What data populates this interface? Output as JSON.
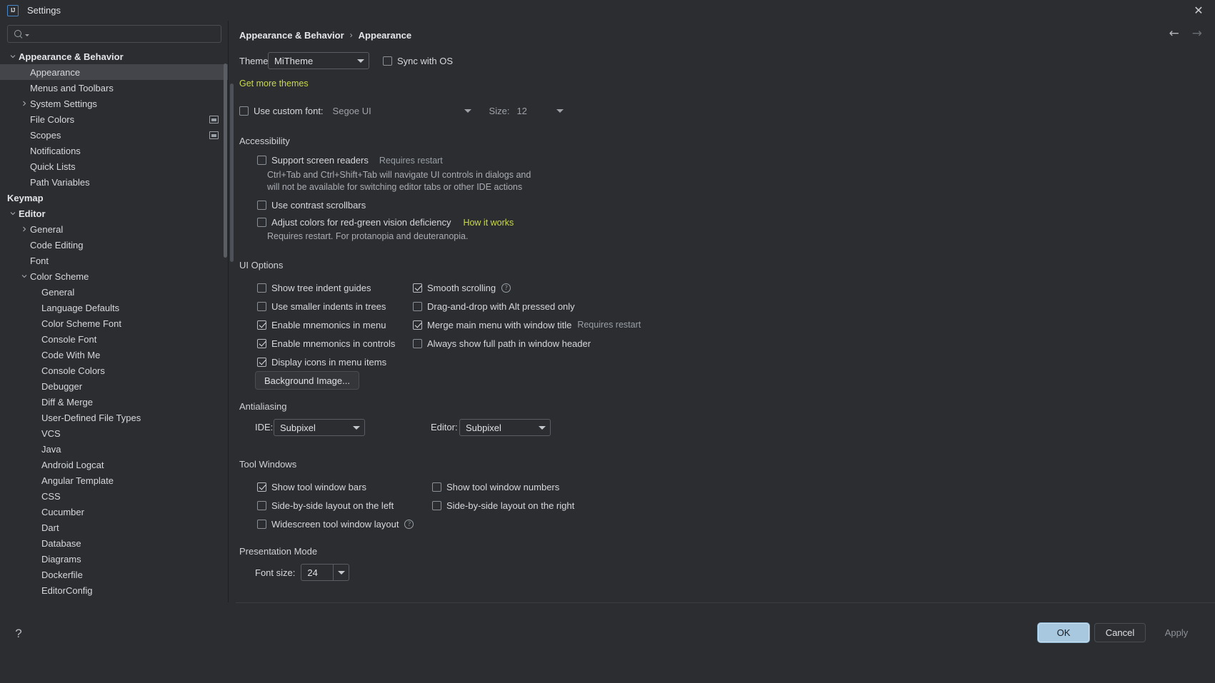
{
  "window": {
    "title": "Settings",
    "logo_text": "IJ",
    "close_label": "✕"
  },
  "search": {
    "value": "",
    "placeholder": ""
  },
  "sidebar": {
    "items": [
      {
        "label": "Appearance & Behavior",
        "level": 0,
        "twisty": "down",
        "bold": true,
        "selected": false,
        "trailing": false
      },
      {
        "label": "Appearance",
        "level": 1,
        "twisty": "none",
        "bold": false,
        "selected": true,
        "trailing": false
      },
      {
        "label": "Menus and Toolbars",
        "level": 1,
        "twisty": "none",
        "bold": false,
        "selected": false,
        "trailing": false
      },
      {
        "label": "System Settings",
        "level": 1,
        "twisty": "right",
        "bold": false,
        "selected": false,
        "trailing": false
      },
      {
        "label": "File Colors",
        "level": 1,
        "twisty": "none",
        "bold": false,
        "selected": false,
        "trailing": true
      },
      {
        "label": "Scopes",
        "level": 1,
        "twisty": "none",
        "bold": false,
        "selected": false,
        "trailing": true
      },
      {
        "label": "Notifications",
        "level": 1,
        "twisty": "none",
        "bold": false,
        "selected": false,
        "trailing": false
      },
      {
        "label": "Quick Lists",
        "level": 1,
        "twisty": "none",
        "bold": false,
        "selected": false,
        "trailing": false
      },
      {
        "label": "Path Variables",
        "level": 1,
        "twisty": "none",
        "bold": false,
        "selected": false,
        "trailing": false
      },
      {
        "label": "Keymap",
        "level": 0,
        "twisty": "none",
        "bold": true,
        "selected": false,
        "trailing": false
      },
      {
        "label": "Editor",
        "level": 0,
        "twisty": "down",
        "bold": true,
        "selected": false,
        "trailing": false
      },
      {
        "label": "General",
        "level": 1,
        "twisty": "right",
        "bold": false,
        "selected": false,
        "trailing": false
      },
      {
        "label": "Code Editing",
        "level": 1,
        "twisty": "none",
        "bold": false,
        "selected": false,
        "trailing": false
      },
      {
        "label": "Font",
        "level": 1,
        "twisty": "none",
        "bold": false,
        "selected": false,
        "trailing": false
      },
      {
        "label": "Color Scheme",
        "level": 1,
        "twisty": "down",
        "bold": false,
        "selected": false,
        "trailing": false
      },
      {
        "label": "General",
        "level": 2,
        "twisty": "none",
        "bold": false,
        "selected": false,
        "trailing": false
      },
      {
        "label": "Language Defaults",
        "level": 2,
        "twisty": "none",
        "bold": false,
        "selected": false,
        "trailing": false
      },
      {
        "label": "Color Scheme Font",
        "level": 2,
        "twisty": "none",
        "bold": false,
        "selected": false,
        "trailing": false
      },
      {
        "label": "Console Font",
        "level": 2,
        "twisty": "none",
        "bold": false,
        "selected": false,
        "trailing": false
      },
      {
        "label": "Code With Me",
        "level": 2,
        "twisty": "none",
        "bold": false,
        "selected": false,
        "trailing": false
      },
      {
        "label": "Console Colors",
        "level": 2,
        "twisty": "none",
        "bold": false,
        "selected": false,
        "trailing": false
      },
      {
        "label": "Debugger",
        "level": 2,
        "twisty": "none",
        "bold": false,
        "selected": false,
        "trailing": false
      },
      {
        "label": "Diff & Merge",
        "level": 2,
        "twisty": "none",
        "bold": false,
        "selected": false,
        "trailing": false
      },
      {
        "label": "User-Defined File Types",
        "level": 2,
        "twisty": "none",
        "bold": false,
        "selected": false,
        "trailing": false
      },
      {
        "label": "VCS",
        "level": 2,
        "twisty": "none",
        "bold": false,
        "selected": false,
        "trailing": false
      },
      {
        "label": "Java",
        "level": 2,
        "twisty": "none",
        "bold": false,
        "selected": false,
        "trailing": false
      },
      {
        "label": "Android Logcat",
        "level": 2,
        "twisty": "none",
        "bold": false,
        "selected": false,
        "trailing": false
      },
      {
        "label": "Angular Template",
        "level": 2,
        "twisty": "none",
        "bold": false,
        "selected": false,
        "trailing": false
      },
      {
        "label": "CSS",
        "level": 2,
        "twisty": "none",
        "bold": false,
        "selected": false,
        "trailing": false
      },
      {
        "label": "Cucumber",
        "level": 2,
        "twisty": "none",
        "bold": false,
        "selected": false,
        "trailing": false
      },
      {
        "label": "Dart",
        "level": 2,
        "twisty": "none",
        "bold": false,
        "selected": false,
        "trailing": false
      },
      {
        "label": "Database",
        "level": 2,
        "twisty": "none",
        "bold": false,
        "selected": false,
        "trailing": false
      },
      {
        "label": "Diagrams",
        "level": 2,
        "twisty": "none",
        "bold": false,
        "selected": false,
        "trailing": false
      },
      {
        "label": "Dockerfile",
        "level": 2,
        "twisty": "none",
        "bold": false,
        "selected": false,
        "trailing": false
      },
      {
        "label": "EditorConfig",
        "level": 2,
        "twisty": "none",
        "bold": false,
        "selected": false,
        "trailing": false
      }
    ]
  },
  "breadcrumb": {
    "parent": "Appearance & Behavior",
    "separator": "›",
    "current": "Appearance"
  },
  "nav": {
    "back": "←",
    "forward": "→"
  },
  "theme": {
    "label": "Theme:",
    "value": "MiTheme",
    "sync_label": "Sync with OS",
    "sync_checked": false,
    "get_more_link": "Get more themes"
  },
  "custom_font": {
    "label": "Use custom font:",
    "checked": false,
    "family": "Segoe UI",
    "size_label": "Size:",
    "size": "12"
  },
  "accessibility": {
    "title": "Accessibility",
    "screen_readers_label": "Support screen readers",
    "screen_readers_checked": false,
    "screen_readers_restart": "Requires restart",
    "screen_readers_desc_line1": "Ctrl+Tab and Ctrl+Shift+Tab will navigate UI controls in dialogs and",
    "screen_readers_desc_line2": "will not be available for switching editor tabs or other IDE actions",
    "contrast_scrollbars_label": "Use contrast scrollbars",
    "contrast_scrollbars_checked": false,
    "red_green_label": "Adjust colors for red-green vision deficiency",
    "red_green_checked": false,
    "how_it_works_link": "How it works",
    "red_green_desc": "Requires restart. For protanopia and deuteranopia."
  },
  "ui_options": {
    "title": "UI Options",
    "left": [
      {
        "label": "Show tree indent guides",
        "checked": false
      },
      {
        "label": "Use smaller indents in trees",
        "checked": false
      },
      {
        "label": "Enable mnemonics in menu",
        "checked": true
      },
      {
        "label": "Enable mnemonics in controls",
        "checked": true
      },
      {
        "label": "Display icons in menu items",
        "checked": true
      }
    ],
    "right": [
      {
        "label": "Smooth scrolling",
        "checked": true,
        "help": true,
        "suffix": ""
      },
      {
        "label": "Drag-and-drop with Alt pressed only",
        "checked": false,
        "help": false,
        "suffix": ""
      },
      {
        "label": "Merge main menu with window title",
        "checked": true,
        "help": false,
        "suffix": "Requires restart"
      },
      {
        "label": "Always show full path in window header",
        "checked": false,
        "help": false,
        "suffix": ""
      }
    ],
    "background_image_button": "Background Image..."
  },
  "antialiasing": {
    "title": "Antialiasing",
    "ide_label": "IDE:",
    "ide_value": "Subpixel",
    "editor_label": "Editor:",
    "editor_value": "Subpixel"
  },
  "tool_windows": {
    "title": "Tool Windows",
    "left": [
      {
        "label": "Show tool window bars",
        "checked": true,
        "help": false
      },
      {
        "label": "Side-by-side layout on the left",
        "checked": false,
        "help": false
      },
      {
        "label": "Widescreen tool window layout",
        "checked": false,
        "help": true
      }
    ],
    "right": [
      {
        "label": "Show tool window numbers",
        "checked": false,
        "help": false
      },
      {
        "label": "Side-by-side layout on the right",
        "checked": false,
        "help": false
      }
    ]
  },
  "presentation_mode": {
    "title": "Presentation Mode",
    "font_size_label": "Font size:",
    "font_size_value": "24"
  },
  "footer": {
    "help": "?",
    "ok": "OK",
    "cancel": "Cancel",
    "apply": "Apply"
  },
  "colors": {
    "background": "#2b2d30",
    "selection": "#43454a",
    "link": "#cbd94b",
    "ok_button": "#a8c8e0",
    "text": "#dfe1e5"
  }
}
